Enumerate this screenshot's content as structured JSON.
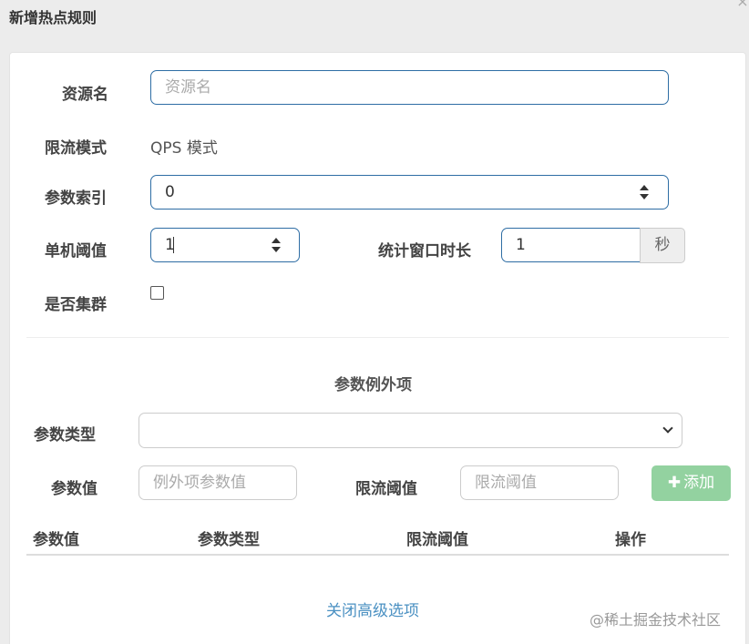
{
  "dialog": {
    "title": "新增热点规则",
    "close_glyph": "×"
  },
  "form": {
    "resource": {
      "label": "资源名",
      "placeholder": "资源名",
      "value": ""
    },
    "mode": {
      "label": "限流模式",
      "value": "QPS 模式"
    },
    "param_index": {
      "label": "参数索引",
      "value": "0"
    },
    "threshold": {
      "label": "单机阈值",
      "value": "1"
    },
    "window": {
      "label": "统计窗口时长",
      "value": "1",
      "unit": "秒"
    },
    "cluster": {
      "label": "是否集群",
      "checked": false
    }
  },
  "exceptions": {
    "title": "参数例外项",
    "param_type": {
      "label": "参数类型",
      "value": ""
    },
    "param_value": {
      "label": "参数值",
      "placeholder": "例外项参数值"
    },
    "limit": {
      "label": "限流阈值",
      "placeholder": "限流阈值"
    },
    "add_button": {
      "icon": "plus-icon",
      "label": "添加",
      "color": "#93d2a0"
    },
    "table": {
      "columns": [
        "参数值",
        "参数类型",
        "限流阈值",
        "操作"
      ]
    }
  },
  "footer": {
    "advanced_link": "关闭高级选项"
  },
  "watermark": "@稀土掘金技术社区"
}
